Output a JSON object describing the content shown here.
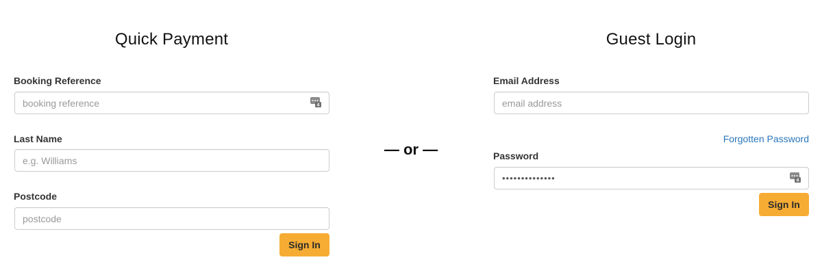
{
  "quick_payment": {
    "title": "Quick Payment",
    "booking_reference": {
      "label": "Booking Reference",
      "placeholder": "booking reference",
      "icon": "password-manager-icon"
    },
    "last_name": {
      "label": "Last Name",
      "placeholder": "e.g. Williams"
    },
    "postcode": {
      "label": "Postcode",
      "placeholder": "postcode"
    },
    "submit_label": "Sign In"
  },
  "divider": {
    "text": "— or —"
  },
  "guest_login": {
    "title": "Guest Login",
    "email": {
      "label": "Email Address",
      "placeholder": "email address"
    },
    "forgot_password_label": "Forgotten Password",
    "password": {
      "label": "Password",
      "value": "••••••••••••••",
      "icon": "password-manager-icon"
    },
    "submit_label": "Sign In"
  },
  "colors": {
    "accent_button": "#f6ac33",
    "link": "#2a76bb"
  }
}
